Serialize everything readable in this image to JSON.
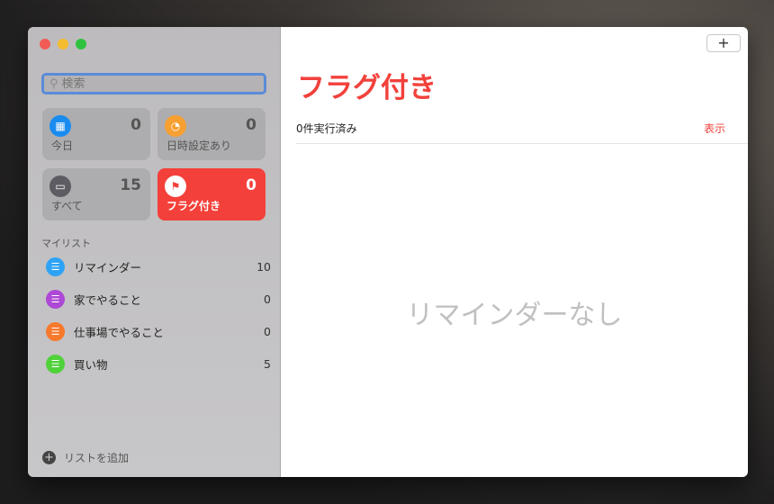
{
  "search": {
    "placeholder": "検索"
  },
  "smart_lists": [
    {
      "label": "今日",
      "count": "0",
      "color": "#1a8cf0"
    },
    {
      "label": "日時設定あり",
      "count": "0",
      "color": "#f7a032"
    },
    {
      "label": "すべて",
      "count": "15",
      "color": "#5c5c62"
    },
    {
      "label": "フラグ付き",
      "count": "0",
      "color": "#f4403a"
    }
  ],
  "my_lists_header": "マイリスト",
  "lists": [
    {
      "label": "リマインダー",
      "count": "10",
      "color": "#2ea3f5"
    },
    {
      "label": "家でやること",
      "count": "0",
      "color": "#ae48d6"
    },
    {
      "label": "仕事場でやること",
      "count": "0",
      "color": "#f6792c"
    },
    {
      "label": "買い物",
      "count": "5",
      "color": "#4fd23a"
    }
  ],
  "add_list": "リストを追加",
  "main": {
    "add_label": "+",
    "title": "フラグ付き",
    "completed": "0件実行済み",
    "show": "表示",
    "empty": "リマインダーなし"
  }
}
